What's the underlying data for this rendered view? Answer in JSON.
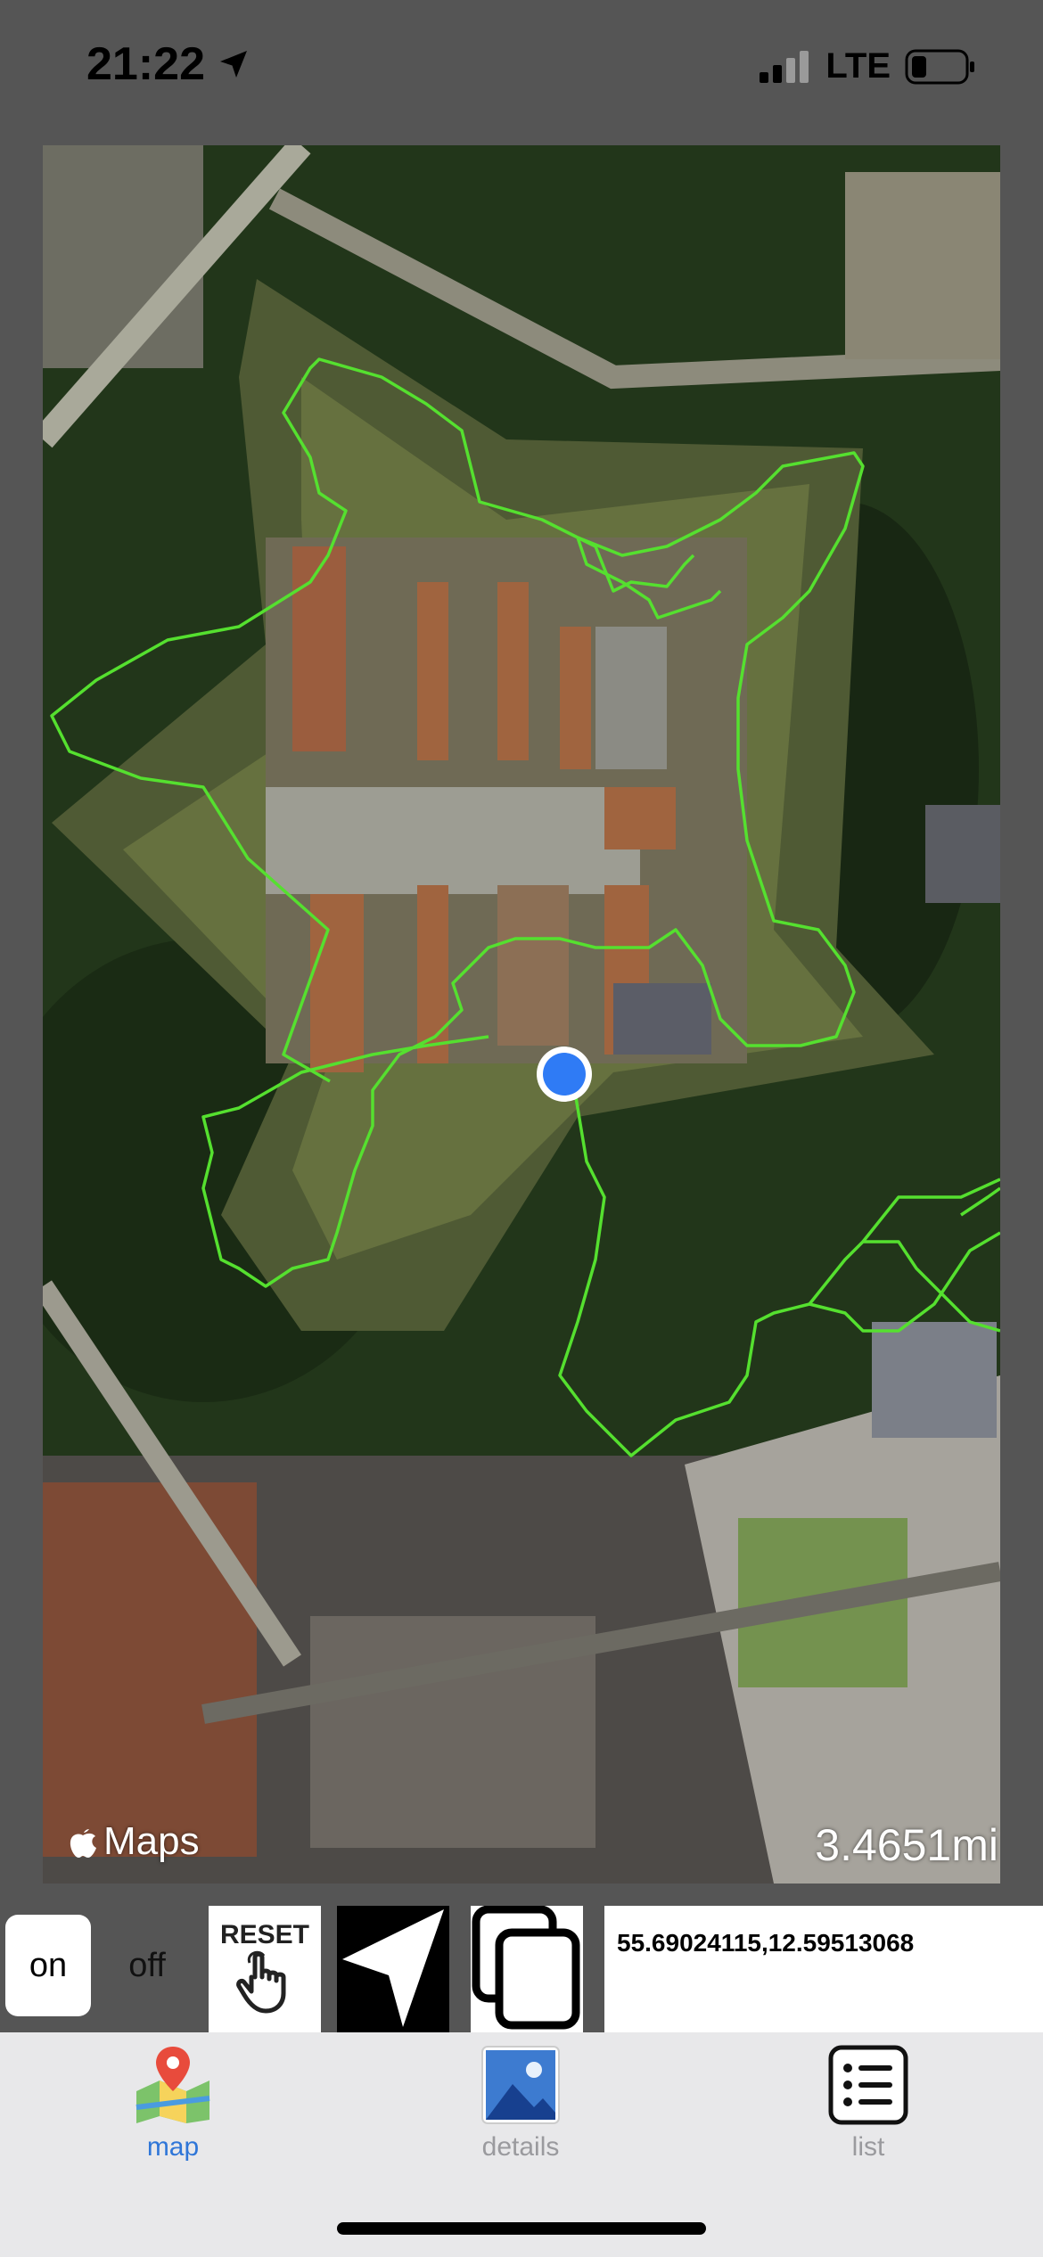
{
  "status": {
    "time": "21:22",
    "network": "LTE"
  },
  "map": {
    "brand": "Maps",
    "scale_label": "3.4651mi",
    "track_color": "#55e02f",
    "location_color": "#2f7bf5"
  },
  "controls": {
    "on_label": "on",
    "off_label": "off",
    "reset_label": "RESET",
    "coordinates": "55.69024115,12.59513068"
  },
  "tabs": [
    {
      "label": "map",
      "icon": "map-icon",
      "color": "#2f76d8"
    },
    {
      "label": "details",
      "icon": "photo-icon",
      "color": "#9a9a9e"
    },
    {
      "label": "list",
      "icon": "list-icon",
      "color": "#9a9a9e"
    }
  ]
}
